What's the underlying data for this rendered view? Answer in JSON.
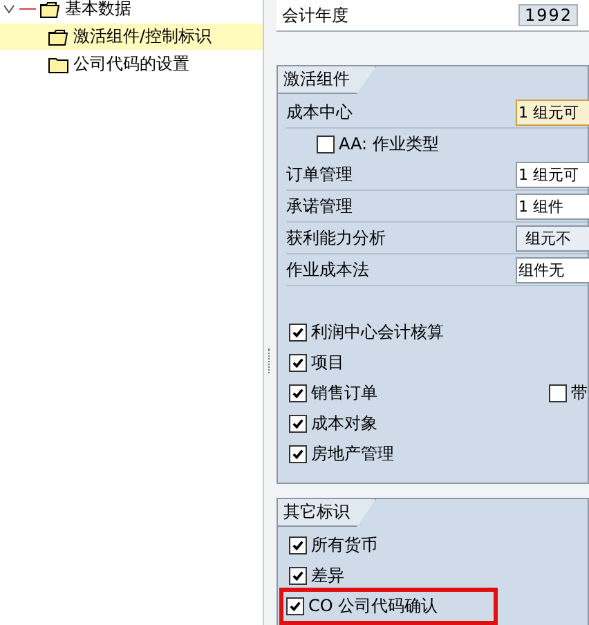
{
  "tree": [
    {
      "label": "基本数据",
      "expanded": true,
      "selected": false,
      "children": [
        {
          "label": "激活组件/控制标识",
          "selected": true,
          "expanded": true
        },
        {
          "label": "公司代码的设置",
          "selected": false,
          "expanded": false
        }
      ]
    }
  ],
  "fiscal_year": {
    "label": "会计年度",
    "value": "1992"
  },
  "groups": [
    {
      "title": "激活组件",
      "rows": [
        {
          "kind": "field",
          "label": "成本中心",
          "value": "1 组元可",
          "focused": true,
          "readonly": false
        },
        {
          "kind": "subcheck",
          "label": "AA: 作业类型",
          "checked": false
        },
        {
          "kind": "field",
          "label": "订单管理",
          "value": "1 组元可",
          "focused": false,
          "readonly": false
        },
        {
          "kind": "field",
          "label": "承诺管理",
          "value": "1 组件",
          "focused": false,
          "readonly": false
        },
        {
          "kind": "field",
          "label": "获利能力分析",
          "value": "组元不",
          "focused": false,
          "readonly": true
        },
        {
          "kind": "field",
          "label": "作业成本法",
          "value": "组件无",
          "focused": false,
          "readonly": false
        },
        {
          "kind": "gap"
        },
        {
          "kind": "check",
          "label": "利润中心会计核算",
          "checked": true
        },
        {
          "kind": "check",
          "label": "项目",
          "checked": true
        },
        {
          "kind": "check",
          "label": "销售订单",
          "checked": true,
          "extra": {
            "label": "带",
            "checked": false
          }
        },
        {
          "kind": "check",
          "label": "成本对象",
          "checked": true
        },
        {
          "kind": "check",
          "label": "房地产管理",
          "checked": true
        }
      ]
    },
    {
      "title": "其它标识",
      "rows": [
        {
          "kind": "check",
          "label": "所有货币",
          "checked": true
        },
        {
          "kind": "check",
          "label": "差异",
          "checked": true
        },
        {
          "kind": "check",
          "label": "CO 公司代码确认",
          "checked": true,
          "highlighted": true
        }
      ]
    }
  ]
}
